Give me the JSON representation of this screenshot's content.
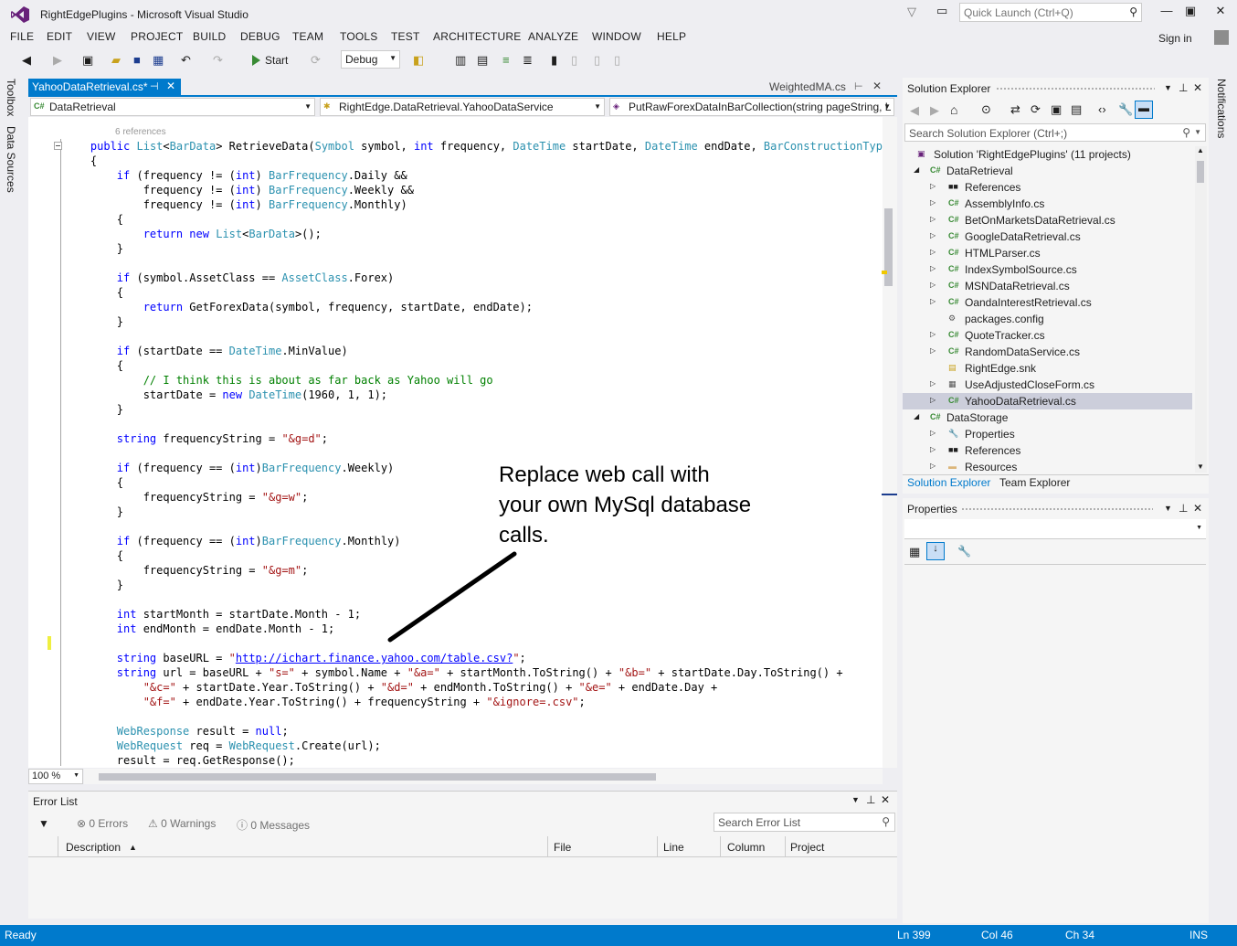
{
  "window": {
    "title": "RightEdgePlugins - Microsoft Visual Studio",
    "quick_launch_placeholder": "Quick Launch (Ctrl+Q)",
    "sign_in": "Sign in"
  },
  "menu": [
    "FILE",
    "EDIT",
    "VIEW",
    "PROJECT",
    "BUILD",
    "DEBUG",
    "TEAM",
    "TOOLS",
    "TEST",
    "ARCHITECTURE",
    "ANALYZE",
    "WINDOW",
    "HELP"
  ],
  "toolbar": {
    "start_label": "Start",
    "configuration": "Debug"
  },
  "left_strip": [
    "Toolbox",
    "Data Sources"
  ],
  "right_strip": [
    "Notifications"
  ],
  "editor": {
    "active_tab": "YahooDataRetrieval.cs*",
    "inactive_tab": "WeightedMA.cs",
    "nav_project": "DataRetrieval",
    "nav_type": "RightEdge.DataRetrieval.YahooDataService",
    "nav_member": "PutRawForexDataInBarCollection(string pageString, L",
    "codelens": "6 references",
    "zoom": "100 %"
  },
  "annotation": "Replace web call with your own MySql database calls.",
  "error_list": {
    "title": "Error List",
    "errors": "0 Errors",
    "warnings": "0 Warnings",
    "messages": "0 Messages",
    "search_placeholder": "Search Error List",
    "columns": [
      "Description",
      "File",
      "Line",
      "Column",
      "Project"
    ]
  },
  "solution_explorer": {
    "title": "Solution Explorer",
    "search_placeholder": "Search Solution Explorer (Ctrl+;)",
    "tabs": [
      "Solution Explorer",
      "Team Explorer"
    ],
    "tree": [
      {
        "label": "Solution 'RightEdgePlugins' (11 projects)",
        "level": 0,
        "expander": "",
        "icon": "solution-icon",
        "glyph": "▣"
      },
      {
        "label": "DataRetrieval",
        "level": 1,
        "expander": "◢",
        "icon": "csharp-project-icon",
        "glyph": "C#"
      },
      {
        "label": "References",
        "level": 2,
        "expander": "▷",
        "icon": "references-icon",
        "glyph": "■■"
      },
      {
        "label": "AssemblyInfo.cs",
        "level": 2,
        "expander": "▷",
        "icon": "csharp-file-icon",
        "glyph": "C#"
      },
      {
        "label": "BetOnMarketsDataRetrieval.cs",
        "level": 2,
        "expander": "▷",
        "icon": "csharp-file-icon",
        "glyph": "C#"
      },
      {
        "label": "GoogleDataRetrieval.cs",
        "level": 2,
        "expander": "▷",
        "icon": "csharp-file-icon",
        "glyph": "C#"
      },
      {
        "label": "HTMLParser.cs",
        "level": 2,
        "expander": "▷",
        "icon": "csharp-file-icon",
        "glyph": "C#"
      },
      {
        "label": "IndexSymbolSource.cs",
        "level": 2,
        "expander": "▷",
        "icon": "csharp-file-icon",
        "glyph": "C#"
      },
      {
        "label": "MSNDataRetrieval.cs",
        "level": 2,
        "expander": "▷",
        "icon": "csharp-file-icon",
        "glyph": "C#"
      },
      {
        "label": "OandaInterestRetrieval.cs",
        "level": 2,
        "expander": "▷",
        "icon": "csharp-file-icon",
        "glyph": "C#"
      },
      {
        "label": "packages.config",
        "level": 2,
        "expander": "",
        "icon": "config-file-icon",
        "glyph": "⚙"
      },
      {
        "label": "QuoteTracker.cs",
        "level": 2,
        "expander": "▷",
        "icon": "csharp-file-icon",
        "glyph": "C#"
      },
      {
        "label": "RandomDataService.cs",
        "level": 2,
        "expander": "▷",
        "icon": "csharp-file-icon",
        "glyph": "C#"
      },
      {
        "label": "RightEdge.snk",
        "level": 2,
        "expander": "",
        "icon": "key-file-icon",
        "glyph": "▤"
      },
      {
        "label": "UseAdjustedCloseForm.cs",
        "level": 2,
        "expander": "▷",
        "icon": "form-file-icon",
        "glyph": "▦"
      },
      {
        "label": "YahooDataRetrieval.cs",
        "level": 2,
        "expander": "▷",
        "icon": "csharp-file-icon",
        "glyph": "C#"
      },
      {
        "label": "DataStorage",
        "level": 1,
        "expander": "◢",
        "icon": "csharp-project-icon",
        "glyph": "C#"
      },
      {
        "label": "Properties",
        "level": 2,
        "expander": "▷",
        "icon": "wrench-icon",
        "glyph": "🔧"
      },
      {
        "label": "References",
        "level": 2,
        "expander": "▷",
        "icon": "references-icon",
        "glyph": "■■"
      },
      {
        "label": "Resources",
        "level": 2,
        "expander": "▷",
        "icon": "folder-icon",
        "glyph": "▬"
      }
    ]
  },
  "properties": {
    "title": "Properties"
  },
  "status": {
    "state": "Ready",
    "line": "Ln 399",
    "col": "Col 46",
    "ch": "Ch 34",
    "mode": "INS"
  },
  "colors": {
    "accent": "#007acc",
    "keyword": "#0000ff",
    "type": "#2b91af",
    "string": "#a31515",
    "comment": "#008000"
  }
}
